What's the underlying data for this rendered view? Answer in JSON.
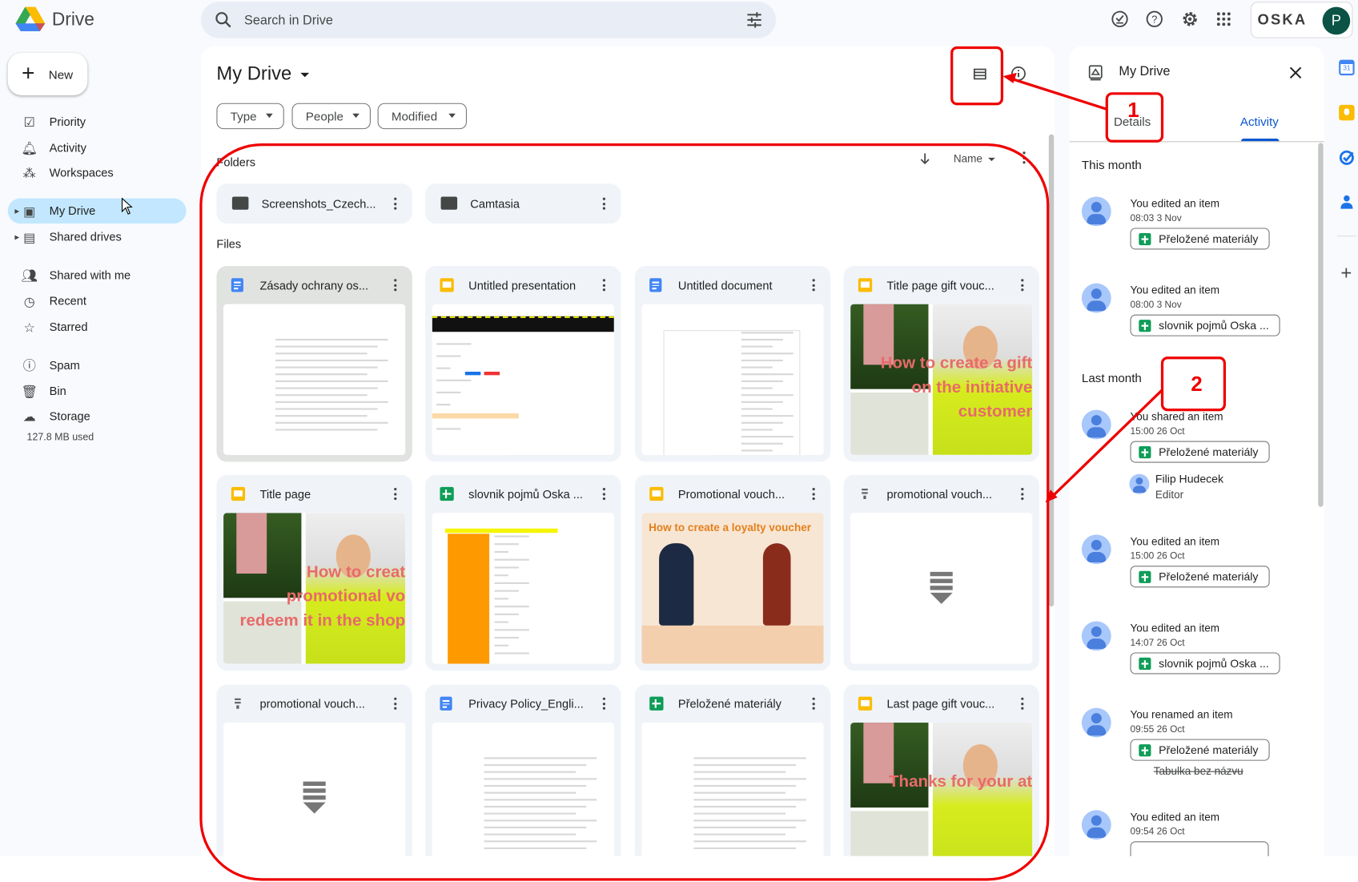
{
  "app": {
    "name": "Drive"
  },
  "search": {
    "placeholder": "Search in Drive"
  },
  "account": {
    "org": "OSKA",
    "avatar_letter": "P",
    "avatar_color": "#0b5344"
  },
  "sidebar": {
    "new_label": "New",
    "items": [
      {
        "label": "Priority",
        "icon": "priority-icon"
      },
      {
        "label": "Activity",
        "icon": "bell-icon"
      },
      {
        "label": "Workspaces",
        "icon": "workspaces-icon"
      },
      {
        "label": "My Drive",
        "icon": "my-drive-icon",
        "active": true
      },
      {
        "label": "Shared drives",
        "icon": "shared-drives-icon"
      },
      {
        "label": "Shared with me",
        "icon": "people-icon"
      },
      {
        "label": "Recent",
        "icon": "clock-icon"
      },
      {
        "label": "Starred",
        "icon": "star-icon"
      },
      {
        "label": "Spam",
        "icon": "spam-icon"
      },
      {
        "label": "Bin",
        "icon": "bin-icon"
      },
      {
        "label": "Storage",
        "icon": "cloud-icon"
      }
    ],
    "storage_used": "127.8 MB used"
  },
  "main": {
    "title": "My Drive",
    "filters": [
      "Type",
      "People",
      "Modified"
    ],
    "folders_label": "Folders",
    "files_label": "Files",
    "sort_label": "Name",
    "folders": [
      {
        "name": "Screenshots_Czech...",
        "shared": true
      },
      {
        "name": "Camtasia",
        "shared": false
      }
    ],
    "files": [
      {
        "name": "Zásady ochrany os...",
        "type": "doc",
        "thumb": "doc",
        "selected": true
      },
      {
        "name": "Untitled presentation",
        "type": "slides",
        "thumb": "ui"
      },
      {
        "name": "Untitled document",
        "type": "doc",
        "thumb": "table"
      },
      {
        "name": "Title page gift vouc...",
        "type": "slides",
        "thumb": "photo",
        "thumb_text": "How to create a gift on the initiative customer"
      },
      {
        "name": "Title page",
        "type": "slides",
        "thumb": "photo",
        "thumb_text": "How to creat promotional vo redeem it in the shop"
      },
      {
        "name": "slovnik pojmů Oska ...",
        "type": "sheet",
        "thumb": "sheet"
      },
      {
        "name": "Promotional vouch...",
        "type": "slides",
        "thumb": "promo",
        "thumb_text": "How to create a loyalty voucher"
      },
      {
        "name": "promotional vouch...",
        "type": "file",
        "thumb": "file"
      },
      {
        "name": "promotional vouch...",
        "type": "file",
        "thumb": "file"
      },
      {
        "name": "Privacy Policy_Engli...",
        "type": "doc",
        "thumb": "doc"
      },
      {
        "name": "Přeložené materiály",
        "type": "sheet",
        "thumb": "doc"
      },
      {
        "name": "Last page gift vouc...",
        "type": "slides",
        "thumb": "photo",
        "thumb_text": "Thanks for your at"
      }
    ]
  },
  "details_panel": {
    "title": "My Drive",
    "tabs": [
      "Details",
      "Activity"
    ],
    "active_tab": "Activity",
    "groups": [
      {
        "label": "This month",
        "entries": [
          {
            "action": "You edited an item",
            "time": "08:03 3 Nov",
            "item": "Přeložené materiály"
          },
          {
            "action": "You edited an item",
            "time": "08:00 3 Nov",
            "item": "slovnik pojmů Oska ..."
          }
        ]
      },
      {
        "label": "Last month",
        "entries": [
          {
            "action": "You shared an item",
            "time": "15:00 26 Oct",
            "item": "Přeložené materiály",
            "shared_with": {
              "name": "Filip Hudecek",
              "role": "Editor"
            }
          },
          {
            "action": "You edited an item",
            "time": "15:00 26 Oct",
            "item": "Přeložené materiály"
          },
          {
            "action": "You edited an item",
            "time": "14:07 26 Oct",
            "item": "slovnik pojmů Oska ..."
          },
          {
            "action": "You renamed an item",
            "time": "09:55 26 Oct",
            "item": "Přeložené materiály",
            "old_name": "Tabulka bez názvu"
          },
          {
            "action": "You edited an item",
            "time": "09:54 26 Oct",
            "item": ""
          }
        ]
      }
    ]
  },
  "annotations": {
    "labels": [
      "1",
      "2"
    ],
    "color": "#e00000"
  }
}
